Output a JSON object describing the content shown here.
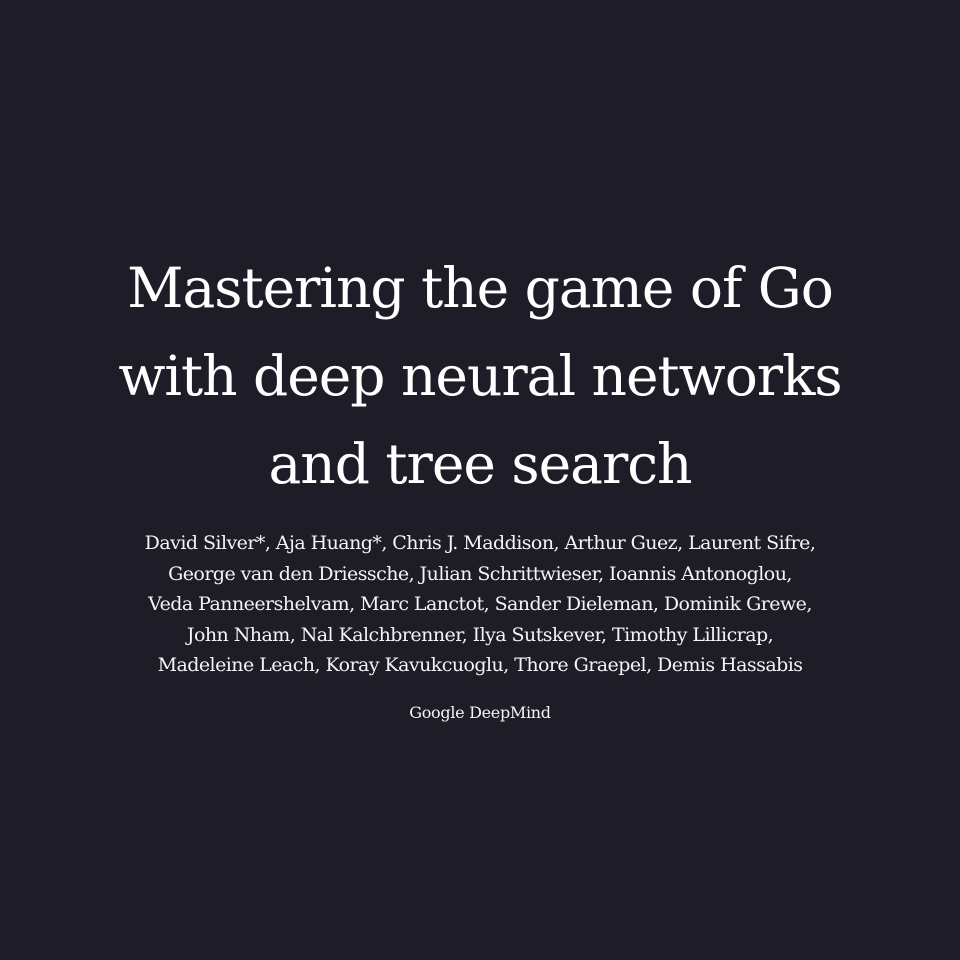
{
  "paper": {
    "title_lines": [
      "Mastering the game of Go",
      "with deep neural networks",
      "and tree search"
    ],
    "author_lines": [
      "David Silver*, Aja Huang*, Chris J. Maddison, Arthur Guez, Laurent Sifre,",
      "George van den Driessche, Julian Schrittwieser, Ioannis Antonoglou,",
      "Veda Panneershelvam, Marc Lanctot, Sander Dieleman, Dominik Grewe,",
      "John Nham, Nal Kalchbrenner, Ilya Sutskever, Timothy Lillicrap,",
      "Madeleine Leach, Koray Kavukcuoglu, Thore Graepel, Demis Hassabis"
    ],
    "affiliation": "Google DeepMind"
  },
  "colors": {
    "background": "#1d1c27",
    "text": "#ffffff"
  }
}
